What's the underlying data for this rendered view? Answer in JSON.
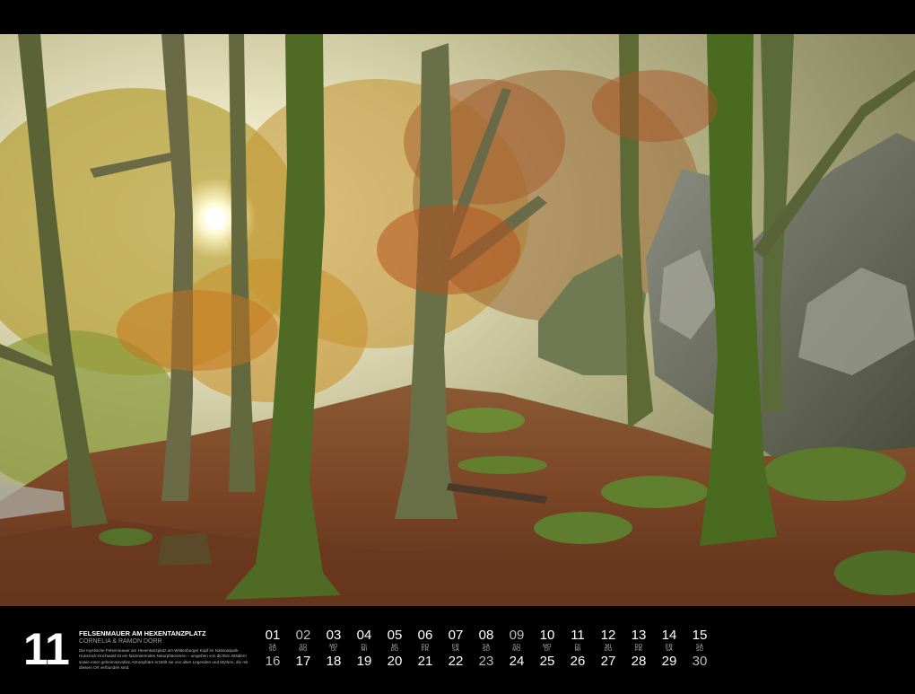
{
  "month": {
    "number": "11",
    "title": "FELSENMAUER AM HEXENTANZPLATZ",
    "author": "CORNELIA & RAMON DÖRR",
    "description": "Die mystische Felsenmauer am Hexentanzplatz am Wildenburger Kopf im Nationalpark Hunsrück-Hochwald ist ein faszinierendes Naturphänomen – umgeben von dichten Wäldern sowie einer geheimnisvollen Atmosphäre erzählt sie von alten Legenden und Mythen, die mit diesem Ort verbunden sind."
  },
  "calendar": {
    "row1": [
      {
        "day": "01",
        "weekday": "SA",
        "sunday": false
      },
      {
        "day": "02",
        "weekday": "SO",
        "sunday": true
      },
      {
        "day": "03",
        "weekday": "MO",
        "sunday": false
      },
      {
        "day": "04",
        "weekday": "DI",
        "sunday": false
      },
      {
        "day": "05",
        "weekday": "MI",
        "sunday": false
      },
      {
        "day": "06",
        "weekday": "DO",
        "sunday": false
      },
      {
        "day": "07",
        "weekday": "FR",
        "sunday": false
      },
      {
        "day": "08",
        "weekday": "SA",
        "sunday": false
      },
      {
        "day": "09",
        "weekday": "SO",
        "sunday": true
      },
      {
        "day": "10",
        "weekday": "MO",
        "sunday": false
      },
      {
        "day": "11",
        "weekday": "DI",
        "sunday": false
      },
      {
        "day": "12",
        "weekday": "MI",
        "sunday": false
      },
      {
        "day": "13",
        "weekday": "DO",
        "sunday": false
      },
      {
        "day": "14",
        "weekday": "FR",
        "sunday": false
      },
      {
        "day": "15",
        "weekday": "SA",
        "sunday": false
      }
    ],
    "row2": [
      {
        "day": "16",
        "weekday": "SO",
        "sunday": true
      },
      {
        "day": "17",
        "weekday": "MO",
        "sunday": false
      },
      {
        "day": "18",
        "weekday": "DI",
        "sunday": false
      },
      {
        "day": "19",
        "weekday": "MI",
        "sunday": false
      },
      {
        "day": "20",
        "weekday": "DO",
        "sunday": false
      },
      {
        "day": "21",
        "weekday": "FR",
        "sunday": false
      },
      {
        "day": "22",
        "weekday": "SA",
        "sunday": false
      },
      {
        "day": "23",
        "weekday": "SO",
        "sunday": true
      },
      {
        "day": "24",
        "weekday": "MO",
        "sunday": false
      },
      {
        "day": "25",
        "weekday": "DI",
        "sunday": false
      },
      {
        "day": "26",
        "weekday": "MI",
        "sunday": false
      },
      {
        "day": "27",
        "weekday": "DO",
        "sunday": false
      },
      {
        "day": "28",
        "weekday": "FR",
        "sunday": false
      },
      {
        "day": "29",
        "weekday": "SA",
        "sunday": false
      },
      {
        "day": "30",
        "weekday": "SO",
        "sunday": true
      }
    ]
  },
  "colors": {
    "background": "#000000",
    "text": "#ffffff",
    "muted": "#bdbdbd"
  }
}
